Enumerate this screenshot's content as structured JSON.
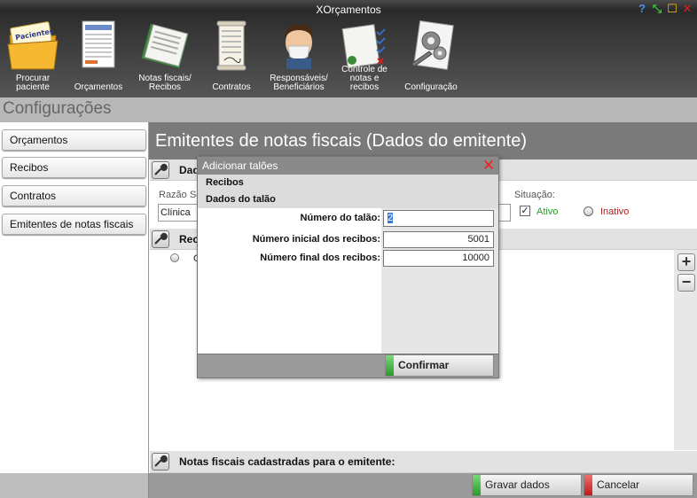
{
  "app": {
    "title": "XOrçamentos"
  },
  "colors": {
    "window_help": "#4a8fe0",
    "window_min": "#3cbf3c",
    "window_max": "#f0c020",
    "window_close": "#e02020",
    "ativo": "#2a9a2a",
    "inativo": "#b02020"
  },
  "toolbar": {
    "items": [
      {
        "label_1": "Procurar",
        "label_2": "paciente",
        "icon": "patients-folder-icon",
        "icon_text": "Pacientes"
      },
      {
        "label_1": "Orçamentos",
        "label_2": "",
        "icon": "budget-document-icon"
      },
      {
        "label_1": "Notas fiscais/",
        "label_2": "Recibos",
        "icon": "invoice-clipboard-icon"
      },
      {
        "label_1": "Contratos",
        "label_2": "",
        "icon": "contract-scroll-icon"
      },
      {
        "label_1": "Responsáveis/",
        "label_2": "Beneficiários",
        "icon": "person-mask-icon"
      },
      {
        "label_1": "Controle de",
        "label_2": "notas e",
        "label_3": "recibos",
        "icon": "checklist-icon"
      },
      {
        "label_1": "Configuração",
        "label_2": "",
        "icon": "settings-gears-icon"
      }
    ]
  },
  "page": {
    "section_title": "Configurações"
  },
  "sidebar": {
    "items": [
      {
        "label": "Orçamentos"
      },
      {
        "label": "Recibos"
      },
      {
        "label": "Contratos"
      },
      {
        "label": "Emitentes de notas fiscais"
      }
    ]
  },
  "main": {
    "title": "Emitentes de notas fiscais  (Dados do emitente)",
    "data_section": "Dad",
    "razao_label": "Razão Se",
    "razao_value": "Clínica",
    "situacao_label": "Situação:",
    "ativo_label": "Ativo",
    "inativo_label": "Inativo",
    "recibos_section": "Rec",
    "list_item_partial": "C",
    "notas_section": "Notas fiscais cadastradas para o emitente:"
  },
  "dialog": {
    "title": "Adicionar talões",
    "subtitle_1": "Recibos",
    "subtitle_2": "Dados do talão",
    "numero_talao_label": "Número do talão:",
    "numero_talao_value": "2",
    "numero_inicial_label": "Número inicial dos recibos:",
    "numero_inicial_value": "5001",
    "numero_final_label": "Número final dos recibos:",
    "numero_final_value": "10000",
    "confirm_label": "Confirmar"
  },
  "actions": {
    "save_label": "Gravar dados",
    "cancel_label": "Cancelar"
  }
}
